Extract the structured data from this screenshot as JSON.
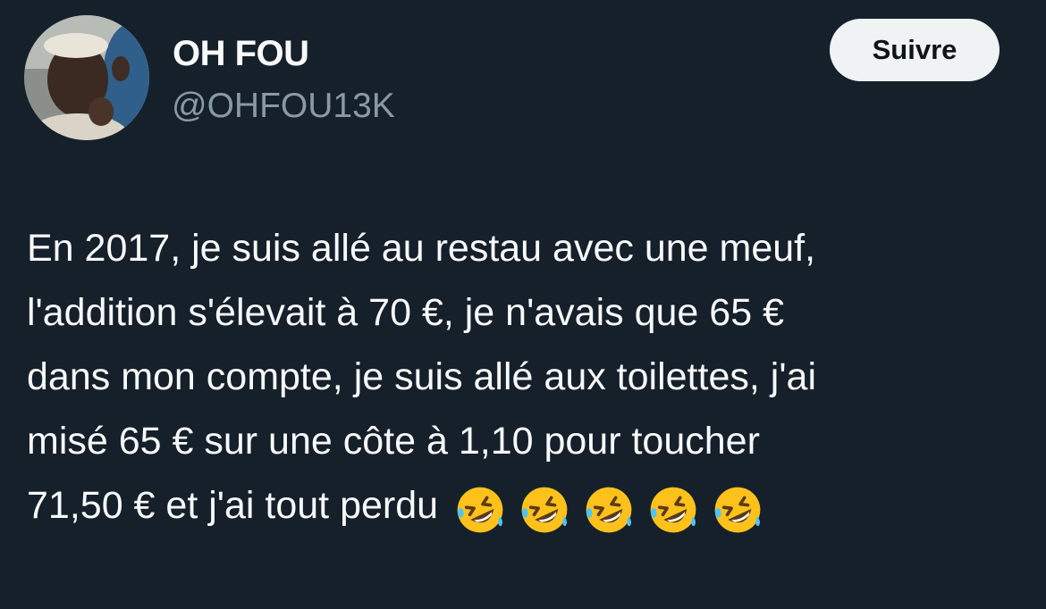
{
  "user": {
    "display_name": "OH FOU",
    "handle": "@OHFOU13K",
    "avatar_icon": "profile-photo"
  },
  "follow_button": {
    "label": "Suivre"
  },
  "tweet": {
    "lines": [
      "En 2017, je suis allé au restau avec une meuf,",
      "l'addition s'élevait à 70 €, je n'avais que 65 €",
      "dans mon compte, je suis allé aux toilettes, j'ai",
      "misé 65 € sur une côte à 1,10 pour toucher",
      "71,50 € et j'ai tout perdu"
    ],
    "emoji": [
      "rolling-on-floor-laughing-icon",
      "rolling-on-floor-laughing-icon",
      "rolling-on-floor-laughing-icon",
      "rolling-on-floor-laughing-icon",
      "rolling-on-floor-laughing-icon"
    ]
  },
  "colors": {
    "background": "#15202b",
    "text_primary": "#f7f9f9",
    "text_secondary": "#8b98a5",
    "button_bg": "#eff3f4",
    "button_text": "#0f1419"
  }
}
